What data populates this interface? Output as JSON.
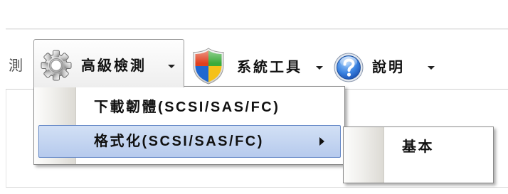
{
  "toolbar": {
    "partial_item": {
      "label": "測"
    },
    "items": [
      {
        "label": "高級檢測",
        "icon": "gear-icon",
        "dropdown_icon": "caret-down-icon",
        "pressed": true
      },
      {
        "label": "系統工具",
        "icon": "shield-icon",
        "dropdown_icon": "caret-down-icon",
        "pressed": false
      },
      {
        "label": "說明",
        "icon": "help-icon",
        "dropdown_icon": "caret-down-icon",
        "pressed": false
      }
    ]
  },
  "menu": {
    "items": [
      {
        "label": "下載韌體(SCSI/SAS/FC)",
        "highlighted": false,
        "has_submenu": false
      },
      {
        "label": "格式化(SCSI/SAS/FC)",
        "highlighted": true,
        "has_submenu": true,
        "submenu_icon": "caret-right-icon"
      }
    ]
  },
  "submenu": {
    "items": [
      {
        "label": "基本",
        "highlighted": false
      }
    ]
  },
  "colors": {
    "text": "#111111",
    "pressed_border": "#9a9a9a",
    "menu_border": "#8a8a8a",
    "highlight_fill_top": "#d2e0f5",
    "highlight_fill_bottom": "#b6caed",
    "highlight_border": "#6387c6",
    "shield_red": "#e0401f",
    "shield_green": "#3bab3a",
    "shield_blue": "#2067d0",
    "shield_yellow": "#f5c11a",
    "help_blue": "#2a6fd2"
  }
}
